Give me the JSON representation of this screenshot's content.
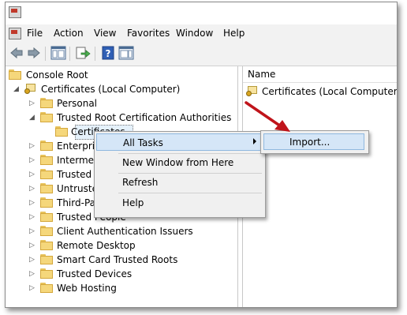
{
  "menubar": {
    "items": [
      "File",
      "Action",
      "View",
      "Favorites",
      "Window",
      "Help"
    ]
  },
  "toolbar": {
    "buttons": [
      "back-arrow-icon",
      "forward-arrow-icon",
      "show-hide-console-tree-icon",
      "export-list-icon",
      "help-icon",
      "show-hide-action-pane-icon"
    ]
  },
  "tree": {
    "console_root": "Console Root",
    "certificates_local": "Certificates (Local Computer)",
    "personal": "Personal",
    "trusted_root": "Trusted Root Certification Authorities",
    "certificates": "Certificates",
    "enterprise": "Enterpris",
    "intermediate": "Intermed",
    "trusted_publishers": "Trusted P",
    "untrusted": "Untruste",
    "third_party": "Third-Pa",
    "trusted_people": "Trusted People",
    "client_auth": "Client Authentication Issuers",
    "remote_desktop": "Remote Desktop",
    "smart_card": "Smart Card Trusted Roots",
    "trusted_devices": "Trusted Devices",
    "web_hosting": "Web Hosting"
  },
  "right_pane": {
    "column_name": "Name",
    "item": "Certificates (Local Computer)"
  },
  "context_menu": {
    "all_tasks": "All Tasks",
    "new_window": "New Window from Here",
    "refresh": "Refresh",
    "help": "Help"
  },
  "submenu": {
    "import": "Import..."
  },
  "colors": {
    "highlight": "#d5e6f7",
    "highlight_border": "#8fb8df",
    "annotation_arrow": "#c0141b"
  }
}
